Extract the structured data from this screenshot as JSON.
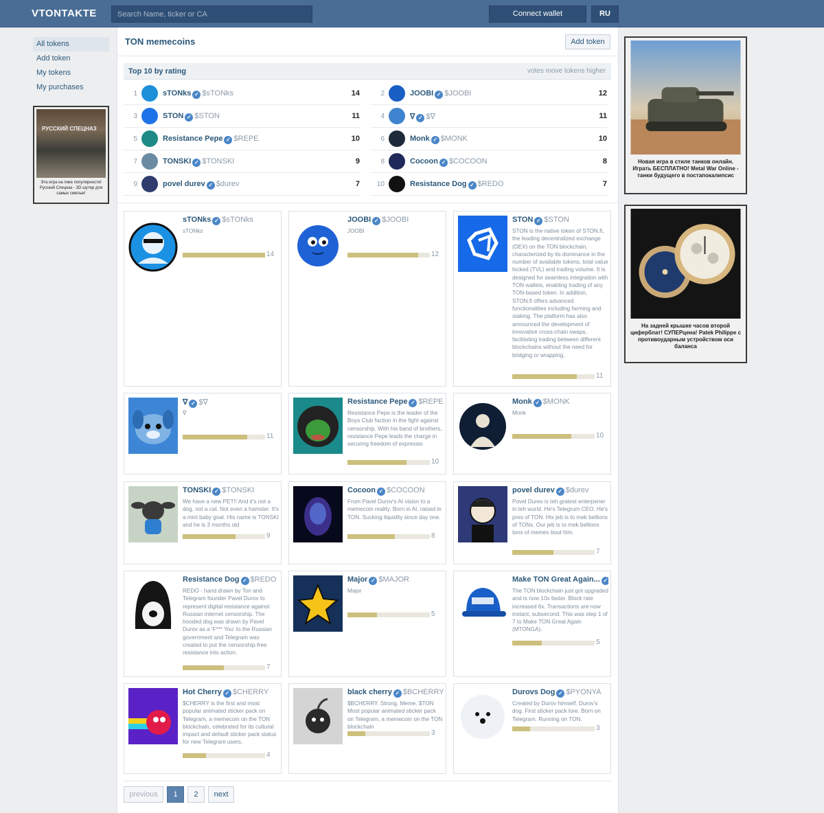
{
  "header": {
    "logo": "VTONTAKTE",
    "search_placeholder": "Search Name, ticker or CA",
    "connect_label": "Connect wallet",
    "lang_label": "RU"
  },
  "nav": [
    "All tokens",
    "Add token",
    "My tokens",
    "My purchases"
  ],
  "ads": {
    "left": {
      "title": "РУССКИЙ СПЕЦНАЗ",
      "caption": "Эта игра на пике популярности! Русский Спецназ - 3D шутер для самых смелых!"
    },
    "right1": {
      "caption": "Новая игра в стиле танков онлайн. Играть БЕСПЛАТНО! Metal War Online - танки будущего в постапокалипсис"
    },
    "right2": {
      "caption": "На задней крышке часов второй циферблат! СУПЕРцена! Patek Philippe с противоударным устройством оси баланса"
    }
  },
  "main": {
    "title": "TON memecoins",
    "add_token": "Add token",
    "top10_title": "Top 10 by rating",
    "top10_hint": "votes move tokens higher"
  },
  "ranking": [
    {
      "rank": "1",
      "name": "sTONks",
      "ticker": "$sTONks",
      "score": "14",
      "color": "#1e8fd9"
    },
    {
      "rank": "2",
      "name": "JOOBI",
      "ticker": "$JOOBI",
      "score": "12",
      "color": "#1a5fc4"
    },
    {
      "rank": "3",
      "name": "STON",
      "ticker": "$STON",
      "score": "11",
      "color": "#1e73e8"
    },
    {
      "rank": "4",
      "name": "∇",
      "ticker": "$∇",
      "score": "11",
      "color": "#3f84cf"
    },
    {
      "rank": "5",
      "name": "Resistance Pepe",
      "ticker": "$REPE",
      "score": "10",
      "color": "#1d8a86"
    },
    {
      "rank": "6",
      "name": "Monk",
      "ticker": "$MONK",
      "score": "10",
      "color": "#1e2a3a"
    },
    {
      "rank": "7",
      "name": "TONSKI",
      "ticker": "$TONSKI",
      "score": "9",
      "color": "#6b8ba3"
    },
    {
      "rank": "8",
      "name": "Cocoon",
      "ticker": "$COCOON",
      "score": "8",
      "color": "#202a5a"
    },
    {
      "rank": "9",
      "name": "povel durev",
      "ticker": "$durev",
      "score": "7",
      "color": "#2e3c6e"
    },
    {
      "rank": "10",
      "name": "Resistance Dog",
      "ticker": "$REDO",
      "score": "7",
      "color": "#111111"
    }
  ],
  "cards": [
    {
      "name": "sTONks",
      "ticker": "$sTONks",
      "desc": "sTONks",
      "score": "14",
      "pct": 1.0,
      "img": "stonks"
    },
    {
      "name": "JOOBI",
      "ticker": "$JOOBI",
      "desc": "JOOBI",
      "score": "12",
      "pct": 0.857,
      "img": "joobi"
    },
    {
      "name": "STON",
      "ticker": "$STON",
      "desc": "STON is the native token of STON.fi, the leading decentralized exchange (DEX) on the TON blockchain, characterized by its dominance in the number of available tokens, total value locked (TVL) and trading volume. It is designed for seamless integration with TON wallets, enabling trading of any TON-based token. In addition, STON.fi offers advanced functionalities including farming and staking. The platform has also announced the development of innovative cross-chain swaps, facilitating trading between different blockchains without the need for bridging or wrapping.",
      "score": "11",
      "pct": 0.786,
      "img": "ston"
    },
    {
      "name": "∇",
      "ticker": "$∇",
      "desc": "∇",
      "score": "11",
      "pct": 0.786,
      "img": "dog"
    },
    {
      "name": "Resistance Pepe",
      "ticker": "$REPE",
      "desc": "Resistance Pepe is the leader of the Boys Club faction in the fight against censorship. With his band of brothers, resistance Pepe leads the charge in securing freedom of expressio",
      "score": "10",
      "pct": 0.714,
      "img": "pepe"
    },
    {
      "name": "Monk",
      "ticker": "$MONK",
      "desc": "Monk",
      "score": "10",
      "pct": 0.714,
      "img": "monk"
    },
    {
      "name": "TONSKI",
      "ticker": "$TONSKI",
      "desc": "We have a new PET!! And it's not a dog, not a cat. Not even a hamster. It's a mini baby goat. His name is TONSKI and he is 3 months old",
      "score": "9",
      "pct": 0.643,
      "img": "tonski"
    },
    {
      "name": "Cocoon",
      "ticker": "$COCOON",
      "desc": "From Pavel Durov's AI vision to a memecoin reality. Born in AI, raised in TON. Sucking liquidity since day one.",
      "score": "8",
      "pct": 0.571,
      "img": "cocoon"
    },
    {
      "name": "povel durev",
      "ticker": "$durev",
      "desc": "Povel Durev is teh gratest enterpener in teh wurld. He's Telegrum CEO. He's pres of TON. His jeb is to mek bellions of TONs. Our jeb is to mek bellions tons of memes bout him.",
      "score": "7",
      "pct": 0.5,
      "img": "durev"
    },
    {
      "name": "Resistance Dog",
      "ticker": "$REDO",
      "desc": "REDO - hand drawn by Ton and Telegram founder Pavel Durov to represent digital resistance against Russian internet censorship. The hooded dog was drawn by Pavel Durov as a 'F*** You' to the Russian government and Telegram was created to put the censorship-free resistance into action.",
      "score": "7",
      "pct": 0.5,
      "img": "redo"
    },
    {
      "name": "Major",
      "ticker": "$MAJOR",
      "desc": "Major",
      "score": "5",
      "pct": 0.357,
      "img": "major"
    },
    {
      "name": "Make TON Great Again...",
      "ticker": "",
      "desc": "The TON blockchain just got upgraded and is now 10x faster. Block rate increased 6x. Transactions are now instant, subsecond. This was step 1 of 7 to Make TON Great Again (MTONGA).",
      "score": "5",
      "pct": 0.357,
      "img": "mtonga"
    },
    {
      "name": "Hot Cherry",
      "ticker": "$CHERRY",
      "desc": "$CHERRY is the first and most popular animated sticker pack on Telegram, a memecoin on the TON blockchain, celebrated for its cultural impact and default sticker pack status for new Telegram users.",
      "score": "4",
      "pct": 0.286,
      "img": "cherry"
    },
    {
      "name": "black cherry",
      "ticker": "$BCHERRY",
      "desc": "$BCHERRY. Strong. Meme. $TON Most popular animated sticker pack on Telegram, a memecoin on the TON blockchain",
      "score": "3",
      "pct": 0.214,
      "img": "bcherry"
    },
    {
      "name": "Durovs Dog",
      "ticker": "$PYONYA",
      "desc": "Created by Durov himself. Durov's dog. First sticker pack lore. Born on Telegram. Running on TON.",
      "score": "3",
      "pct": 0.214,
      "img": "pyonya"
    }
  ],
  "pagination": {
    "prev": "previous",
    "pages": [
      "1",
      "2"
    ],
    "next": "next"
  }
}
